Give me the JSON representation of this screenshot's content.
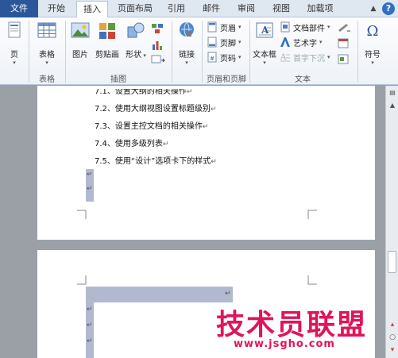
{
  "tabs": {
    "file": "文件",
    "items": [
      "开始",
      "插入",
      "页面布局",
      "引用",
      "邮件",
      "审阅",
      "视图",
      "加载项"
    ],
    "active": "插入",
    "help": "?"
  },
  "ribbon": {
    "groups": {
      "pages": "",
      "tables": "表格",
      "illustrations": "插图",
      "links": "",
      "header_footer": "页眉和页脚",
      "text": "文本",
      "symbols": ""
    },
    "buttons": {
      "page": "页",
      "table": "表格",
      "picture": "图片",
      "clipart": "剪贴画",
      "shapes": "形状",
      "link": "链接",
      "header": "页眉",
      "footer": "页脚",
      "page_number": "页码",
      "textbox": "文本框",
      "quickparts": "文档部件",
      "wordart": "艺术字",
      "dropcap": "首字下沉",
      "symbol": "符号"
    }
  },
  "document": {
    "page1_lines": [
      "7.1、设置大纲的相关操作",
      "7.2、使用大纲视图设置标题级别",
      "7.3、设置主控文档的相关操作",
      "7.4、使用多级列表",
      "7.5、使用“设计”选项卡下的样式"
    ],
    "paragraph_mark": "↵"
  },
  "watermark": {
    "title": "技术员联盟",
    "url": "www.jsgho.com"
  },
  "colors": {
    "file_tab": "#2b579a",
    "selection": "#b2b8cf",
    "watermark": "#e0145a"
  }
}
